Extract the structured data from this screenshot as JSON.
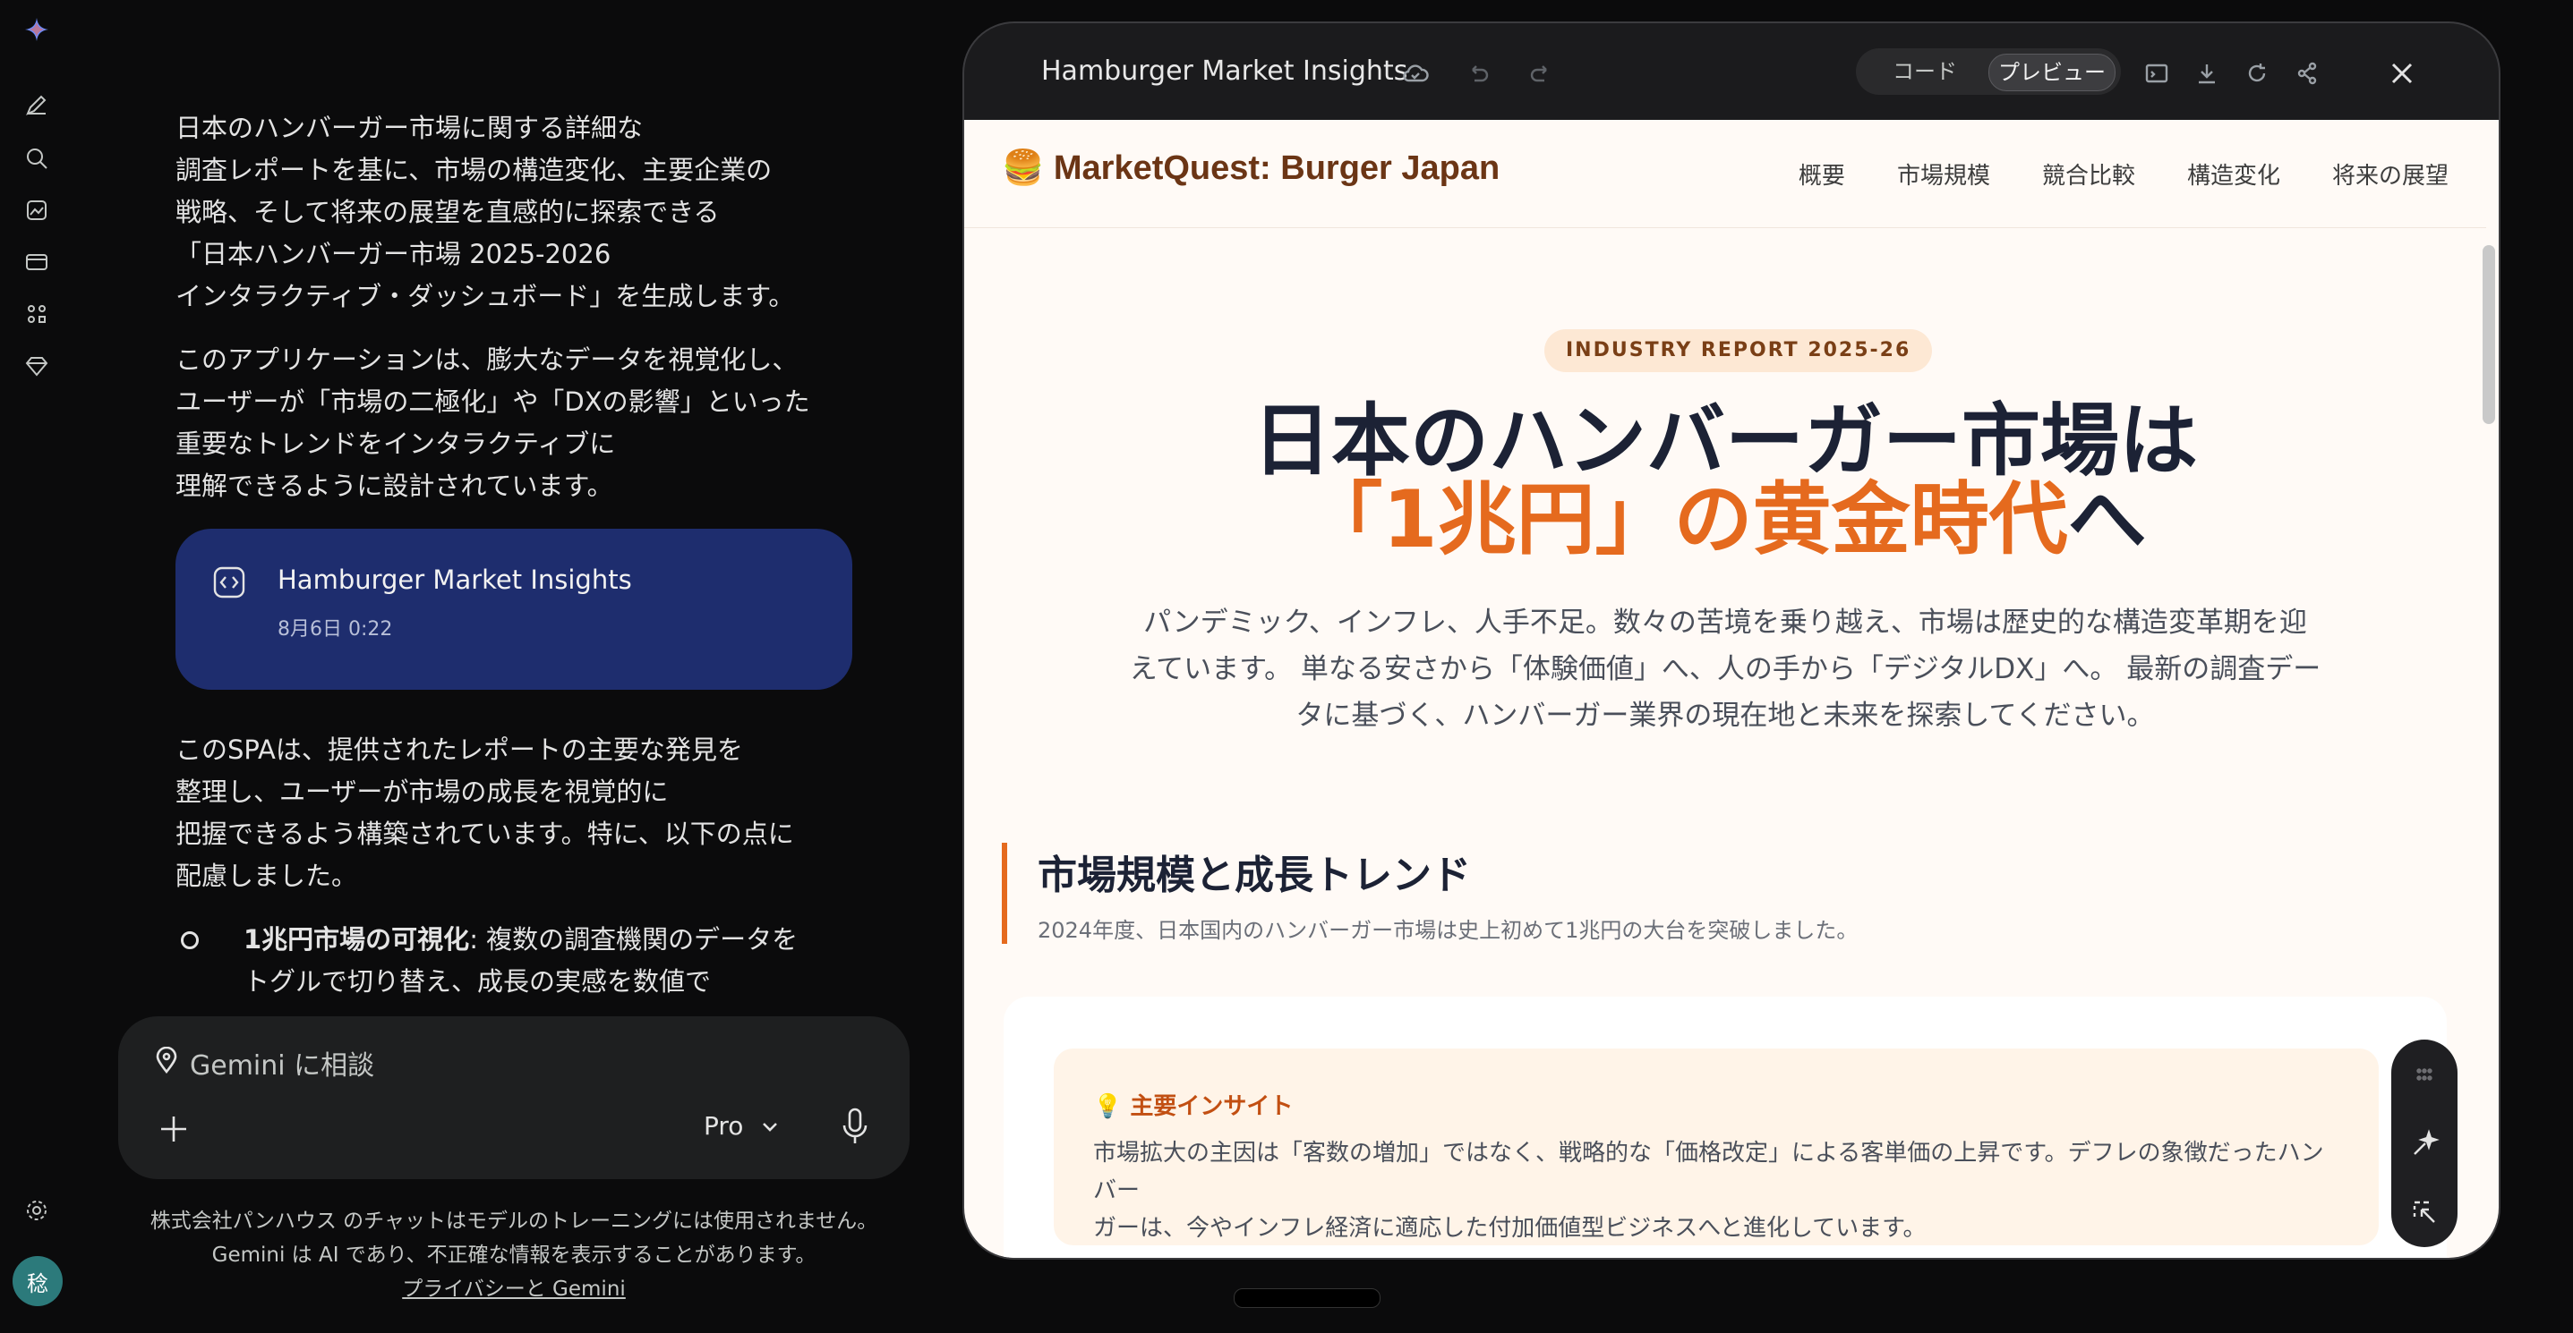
{
  "chat": {
    "para1": [
      "日本のハンバーガー市場に関する詳細な",
      "調査レポートを基に、市場の構造変化、主要企業の",
      "戦略、そして将来の展望を直感的に探索できる",
      "「日本ハンバーガー市場 2025-2026",
      "インタラクティブ・ダッシュボード」を生成します。"
    ],
    "para2": [
      "このアプリケーションは、膨大なデータを視覚化し、",
      "ユーザーが「市場の二極化」や「DXの影響」といった",
      "重要なトレンドをインタラクティブに",
      "理解できるように設計されています。"
    ],
    "artifact": {
      "title": "Hamburger Market Insights",
      "date": "8月6日 0:22"
    },
    "para3": [
      "このSPAは、提供されたレポートの主要な発見を",
      "整理し、ユーザーが市場の成長を視覚的に",
      "把握できるよう構築されています。特に、以下の点に",
      "配慮しました。"
    ],
    "bullet1": {
      "bold": "1兆円市場の可視化",
      "rest1": ": 複数の調査機関のデータを",
      "rest2": "トグルで切り替え、成長の実感を数値で"
    }
  },
  "input": {
    "placeholder": "Gemini に相談",
    "model": "Pro"
  },
  "disclaimer": {
    "line1": "株式会社パンハウス のチャットはモデルのトレーニングには使用されません。",
    "line2": "Gemini は AI であり、不正確な情報を表示することがあります。",
    "link": "プライバシーと Gemini"
  },
  "avatar": {
    "initial": "稔"
  },
  "panel": {
    "title": "Hamburger Market Insights",
    "code_label": "コード",
    "preview_label": "プレビュー"
  },
  "site": {
    "brand": "🍔 MarketQuest: Burger Japan",
    "nav": [
      "概要",
      "市場規模",
      "競合比較",
      "構造変化",
      "将来の展望"
    ],
    "badge": "INDUSTRY REPORT 2025-26",
    "hero_line1": "日本のハンバーガー市場は",
    "hero_line2_accent": "「1兆円」の黄金時代",
    "hero_line2_tail": "へ",
    "lead": [
      "パンデミック、インフレ、人手不足。数々の苦境を乗り越え、市場は歴史的な構造変革期を迎",
      "えています。 単なる安さから「体験価値」へ、人の手から「デジタルDX」へ。 最新の調査デー",
      "タに基づく、ハンバーガー業界の現在地と未来を探索してください。"
    ],
    "section_title": "市場規模と成長トレンド",
    "section_sub": "2024年度、日本国内のハンバーガー市場は史上初めて1兆円の大台を突破しました。",
    "insight_title": "💡 主要インサイト",
    "insight_body": [
      "市場拡大の主因は「客数の増加」ではなく、戦略的な「価格改定」による客単価の上昇です。デフレの象徴だったハンバー",
      "ガーは、今やインフレ経済に適応した付加価値型ビジネスへと進化しています。"
    ]
  },
  "colors": {
    "accent": "#e56a1e",
    "artifact_bg": "#1e2d6e",
    "app_bg": "#0b0b0c"
  }
}
